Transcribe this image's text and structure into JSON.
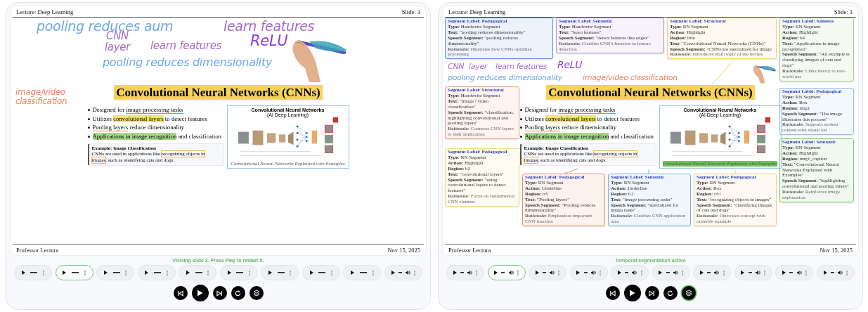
{
  "panels": [
    {
      "header": {
        "title": "Lecture: Deep Learning",
        "slide": "Slide: 3"
      },
      "handwriting": [
        {
          "text": "pooling reduces aum",
          "color": "#6fa8e8"
        },
        {
          "text": "learn features",
          "color": "#a66cc7"
        },
        {
          "text": "CNN",
          "color": "#a66cc7"
        },
        {
          "text": "layer",
          "color": "#a66cc7"
        },
        {
          "text": "learn features",
          "color": "#a66cc7"
        },
        {
          "text": "ReLU",
          "color": "#8a3fe0"
        },
        {
          "text": "pooling reduces dimensionality",
          "color": "#6fa8e8"
        },
        {
          "text": "image/video classification",
          "color": "#ee8461"
        }
      ],
      "title": "Convolutional Neural Networks (CNNs)",
      "bullets": [
        {
          "segments": [
            {
              "text": "Designed for ",
              "kind": "plain"
            },
            {
              "text": "image processing tasks",
              "kind": "underline",
              "color": "#5aa9e6"
            }
          ]
        },
        {
          "segments": [
            {
              "text": "Utilizes ",
              "kind": "plain"
            },
            {
              "text": "convolutional layers",
              "kind": "highlight",
              "color": "#f7e463"
            },
            {
              "text": " to detect features",
              "kind": "plain"
            }
          ]
        },
        {
          "segments": [
            {
              "text": "Pooling layers",
              "kind": "underline",
              "color": "#e9805f"
            },
            {
              "text": " reduce dimensionality",
              "kind": "plain"
            }
          ]
        },
        {
          "segments": [
            {
              "text": "Applications in image recognition",
              "kind": "highlight",
              "color": "#a5d98a"
            },
            {
              "text": " and classification",
              "kind": "plain"
            }
          ]
        }
      ],
      "example": {
        "title": "Example: Image Classification",
        "segments": [
          {
            "text": "CNNs are used in applications like ",
            "kind": "plain"
          },
          {
            "text": "recognizing objects in images",
            "kind": "box",
            "color": "#f2b15c"
          },
          {
            "text": ", such as identifying cats and dogs.",
            "kind": "plain"
          }
        ]
      },
      "figure": {
        "title": "Convolutional Neural Networks",
        "subtitle": "(AI Deep Learning)",
        "caption": {
          "text": "Convolutional Neural Networks Explained with Examples",
          "kind": "plain"
        }
      },
      "footer": {
        "presenter": "Professor Lectura",
        "date": "Nov 15, 2025"
      },
      "status": "Viewing slide 3. Press Play to restart it.",
      "clips": [
        {
          "kind": "plain",
          "selected": false
        },
        {
          "kind": "plain",
          "selected": true
        },
        {
          "kind": "plain",
          "selected": false
        },
        {
          "kind": "plain",
          "selected": false
        },
        {
          "kind": "plain",
          "selected": false
        },
        {
          "kind": "plain",
          "selected": false
        },
        {
          "kind": "plain",
          "selected": false
        },
        {
          "kind": "plain",
          "selected": false
        },
        {
          "kind": "plain",
          "selected": false
        },
        {
          "kind": "audio",
          "selected": false
        }
      ],
      "controls": [
        {
          "kind": "previous",
          "active": false
        },
        {
          "kind": "play",
          "active": false
        },
        {
          "kind": "next",
          "active": false
        },
        {
          "kind": "replay",
          "active": false
        },
        {
          "kind": "layers",
          "active": false
        }
      ]
    },
    {
      "header": {
        "title": "Lecture: Deep Learning",
        "slide": "Slide: 3"
      },
      "handwriting": [
        {
          "text": "CNN",
          "color": "#a66cc7"
        },
        {
          "text": "layer",
          "color": "#a66cc7"
        },
        {
          "text": "learn features",
          "color": "#a66cc7"
        },
        {
          "text": "ReLU",
          "color": "#8a3fe0"
        },
        {
          "text": "pooling reduces dimensionality",
          "color": "#6fa8e8"
        },
        {
          "text": "image/video classification",
          "color": "#ee8461"
        }
      ],
      "title": "Convolutional Neural Networks (CNNs)",
      "bullets": [
        {
          "segments": [
            {
              "text": "Designed for ",
              "kind": "plain"
            },
            {
              "text": "image processing tasks",
              "kind": "underline",
              "color": "#5aa9e6"
            }
          ]
        },
        {
          "segments": [
            {
              "text": "Utilizes ",
              "kind": "plain"
            },
            {
              "text": "convolutional layers",
              "kind": "highlight",
              "color": "#f7e463"
            },
            {
              "text": " to detect features",
              "kind": "plain"
            }
          ]
        },
        {
          "segments": [
            {
              "text": "Pooling layers",
              "kind": "underline",
              "color": "#e9805f"
            },
            {
              "text": " reduce dimensionality",
              "kind": "plain"
            }
          ]
        },
        {
          "segments": [
            {
              "text": "Applications in image recognition",
              "kind": "highlight",
              "color": "#a5d98a"
            },
            {
              "text": " and classification",
              "kind": "plain"
            }
          ]
        }
      ],
      "example": {
        "title": "Example: Image Classification",
        "segments": [
          {
            "text": "CNNs are used in applications like ",
            "kind": "plain"
          },
          {
            "text": "recognizing objects in images",
            "kind": "box",
            "color": "#f2b15c"
          },
          {
            "text": ", such as identifying cats and dogs.",
            "kind": "plain"
          }
        ]
      },
      "figure": {
        "title": "Convolutional Neural Networks",
        "subtitle": "(AI Deep Learning)",
        "caption": {
          "text": "Convolutional Neural Networks Explained with Examples",
          "kind": "highlight",
          "color": "#6cc35a"
        }
      },
      "segments": [
        {
          "color": "#5b8ee6",
          "label": "Segment Label: Pedagogical",
          "fields": [
            {
              "key": "Type:",
              "value": "Handwrite Segment"
            },
            {
              "key": "Text:",
              "value": "\"pooling reduces dimensionality\""
            },
            {
              "key": "Speech Segment:",
              "value": "\"pooling reduces dimensionality\""
            }
          ],
          "rationale": {
            "key": "Rationale:",
            "value": "Illustrates how CNNs optimize processing"
          }
        },
        {
          "color": "#b58fd9",
          "label": "Segment Label: Semantic",
          "fields": [
            {
              "key": "Type:",
              "value": "Handwrite Segment"
            },
            {
              "key": "Text:",
              "value": "\"learn features\""
            },
            {
              "key": "Speech Segment:",
              "value": "\"detect features like edges\""
            }
          ],
          "rationale": {
            "key": "Rationale:",
            "value": "Clarifies CNN's function in feature detection"
          }
        },
        {
          "color": "#eb9a80",
          "label": "Segment Label: Structural",
          "fields": [
            {
              "key": "Type:",
              "value": "Handwrite Segment"
            },
            {
              "key": "Text:",
              "value": "\"image / video classification\""
            },
            {
              "key": "Speech Segment:",
              "value": "\"classification, highlighting convolutional and pooling layers\""
            }
          ],
          "rationale": {
            "key": "Rationale:",
            "value": "Connects CNN layers to their application"
          }
        },
        {
          "color": "#f2d36b",
          "label": "Segment Label: Structural",
          "fields": [
            {
              "key": "Type:",
              "value": "RN Segment"
            },
            {
              "key": "Action:",
              "value": "Highlight"
            },
            {
              "key": "Region:",
              "value": "title"
            },
            {
              "key": "Text:",
              "value": "\"Convolutional Neural Networks (CNNs)\""
            },
            {
              "key": "Speech Segment:",
              "value": "\"CNNs are specialized for image"
            }
          ],
          "rationale": {
            "key": "Rationale:",
            "value": "Introduces main topic of the lecture"
          }
        },
        {
          "color": "#9fd18a",
          "label": "Segment Label: Salience",
          "fields": [
            {
              "key": "Type:",
              "value": "RN Segment"
            },
            {
              "key": "Action:",
              "value": "Highlight"
            },
            {
              "key": "Region:",
              "value": "b4"
            },
            {
              "key": "Text:",
              "value": "\"Applications in image recognition\""
            },
            {
              "key": "Speech Segment:",
              "value": "\"An example is classifying images of cats and dogs\""
            }
          ],
          "rationale": {
            "key": "Rationale:",
            "value": "Links theory to real-world use"
          }
        },
        {
          "color": "#8fbde9",
          "label": "Segment Label: Pedagogical",
          "fields": [
            {
              "key": "Type:",
              "value": "RN Segment"
            },
            {
              "key": "Action:",
              "value": "Box"
            },
            {
              "key": "Region:",
              "value": "img1"
            },
            {
              "key": "Speech Segment:",
              "value": "\"The image illustrates this process\""
            }
          ],
          "rationale": {
            "key": "Rationale:",
            "value": "Supports spoken content with visual aid"
          }
        },
        {
          "color": "#f2de7a",
          "label": "Segment Label: Pedagogical",
          "fields": [
            {
              "key": "Type:",
              "value": "RN Segment"
            },
            {
              "key": "Action:",
              "value": "Highlight"
            },
            {
              "key": "Region:",
              "value": "b2"
            },
            {
              "key": "Text:",
              "value": "\"convolutional layers\""
            },
            {
              "key": "Speech Segment:",
              "value": "\"using convolutional layers to detect features\""
            }
          ],
          "rationale": {
            "key": "Rationale:",
            "value": "Focus on fundamental CNN element"
          }
        },
        {
          "color": "#7cc86a",
          "label": "Segment Label: Semantic",
          "fields": [
            {
              "key": "Type:",
              "value": "RN Segment"
            },
            {
              "key": "Action:",
              "value": "Highlight"
            },
            {
              "key": "Region:",
              "value": "img1_caption"
            },
            {
              "key": "Text:",
              "value": "\"Convolutional Neural Networks Explained with Examples\""
            },
            {
              "key": "Speech Segment:",
              "value": "\"highlighting convolutional and pooling layers\""
            }
          ],
          "rationale": {
            "key": "Rationale:",
            "value": "Reinforces image explanation"
          }
        },
        {
          "color": "#e8906f",
          "label": "Segment Label: Pedagogical",
          "fields": [
            {
              "key": "Type:",
              "value": "RN Segment"
            },
            {
              "key": "Action:",
              "value": "Underline"
            },
            {
              "key": "Region:",
              "value": "b3"
            },
            {
              "key": "Text:",
              "value": "\"Pooling layers\""
            },
            {
              "key": "Speech Segment:",
              "value": "\"Pooling reduces dimensionality\""
            }
          ],
          "rationale": {
            "key": "Rationale:",
            "value": "Emphasizes important CNN function"
          }
        },
        {
          "color": "#6fb6ea",
          "label": "Segment Label: Semantic",
          "fields": [
            {
              "key": "Type:",
              "value": "RN Segment"
            },
            {
              "key": "Action:",
              "value": "Underline"
            },
            {
              "key": "Region:",
              "value": "b1"
            },
            {
              "key": "Text:",
              "value": "\"image processing tasks\""
            },
            {
              "key": "Speech Segment:",
              "value": "\"specialized for image tasks\""
            }
          ],
          "rationale": {
            "key": "Rationale:",
            "value": "Clarifies CNN application area"
          }
        },
        {
          "color": "#f2c98a",
          "label": "Segment Label: Pedagogical",
          "fields": [
            {
              "key": "Type:",
              "value": "RN Segment"
            },
            {
              "key": "Action:",
              "value": "Box"
            },
            {
              "key": "Region:",
              "value": "cb1"
            },
            {
              "key": "Text:",
              "value": "\"recognizing objects in images\""
            },
            {
              "key": "Speech Segment:",
              "value": "\"classifying images of cats and dogs\""
            }
          ],
          "rationale": {
            "key": "Rationale:",
            "value": "Illustrates concept with relatable example"
          }
        }
      ],
      "footer": {
        "presenter": "Professor Lectura",
        "date": "Nov 15, 2025"
      },
      "status": "Temporal segmentation active",
      "clips": [
        {
          "kind": "audio",
          "selected": false
        },
        {
          "kind": "audio",
          "selected": true
        },
        {
          "kind": "audio",
          "selected": false
        },
        {
          "kind": "audio",
          "selected": false
        },
        {
          "kind": "audio",
          "selected": false
        },
        {
          "kind": "audio",
          "selected": false
        },
        {
          "kind": "audio",
          "selected": false
        },
        {
          "kind": "audio",
          "selected": false
        },
        {
          "kind": "audio",
          "selected": false
        },
        {
          "kind": "audio",
          "selected": false
        }
      ],
      "controls": [
        {
          "kind": "previous",
          "active": false
        },
        {
          "kind": "play",
          "active": false
        },
        {
          "kind": "next",
          "active": false
        },
        {
          "kind": "replay",
          "active": false
        },
        {
          "kind": "layers",
          "active": true
        }
      ]
    }
  ]
}
